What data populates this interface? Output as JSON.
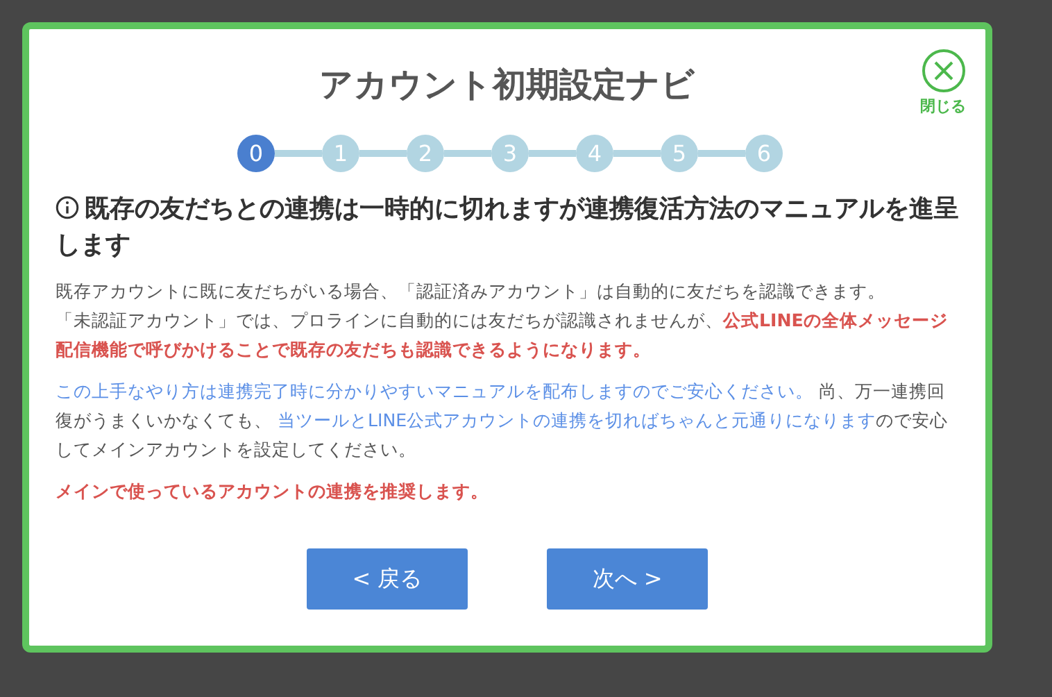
{
  "dialog": {
    "title": "アカウント初期設定ナビ",
    "close_label": "閉じる"
  },
  "steps": [
    {
      "label": "0",
      "selected": true
    },
    {
      "label": "1",
      "selected": false
    },
    {
      "label": "2",
      "selected": false
    },
    {
      "label": "3",
      "selected": false
    },
    {
      "label": "4",
      "selected": false
    },
    {
      "label": "5",
      "selected": false
    },
    {
      "label": "6",
      "selected": false
    }
  ],
  "heading": "既存の友だちとの連携は一時的に切れますが連携復活方法のマニュアルを進呈します",
  "paragraphs": [
    {
      "segments": [
        {
          "kind": "plain",
          "text": "既存アカウントに既に友だちがいる場合、「認証済みアカウント」は自動的に友だちを認識できます。"
        },
        {
          "kind": "break"
        },
        {
          "kind": "plain",
          "text": "「未認証アカウント」では、プロラインに自動的には友だちが認識されませんが、"
        },
        {
          "kind": "alert",
          "text": "公式LINEの全体メッセージ配信機能で呼びかけることで既存の友だちも認識できるようになります。"
        }
      ]
    },
    {
      "segments": [
        {
          "kind": "note",
          "text": "この上手なやり方は連携完了時に分かりやすいマニュアルを配布しますのでご安心ください。"
        },
        {
          "kind": "plain",
          "text": " 尚、万一連携回復がうまくいかなくても、 "
        },
        {
          "kind": "note",
          "text": "当ツールとLINE公式アカウントの連携を切ればちゃんと元通りになります"
        },
        {
          "kind": "plain",
          "text": "ので安心してメインアカウントを設定してください。"
        }
      ]
    },
    {
      "segments": [
        {
          "kind": "alert",
          "text": "メインで使っているアカウントの連携を推奨します。"
        }
      ]
    }
  ],
  "buttons": [
    {
      "label": "< 戻る"
    },
    {
      "label": "次へ >"
    }
  ]
}
